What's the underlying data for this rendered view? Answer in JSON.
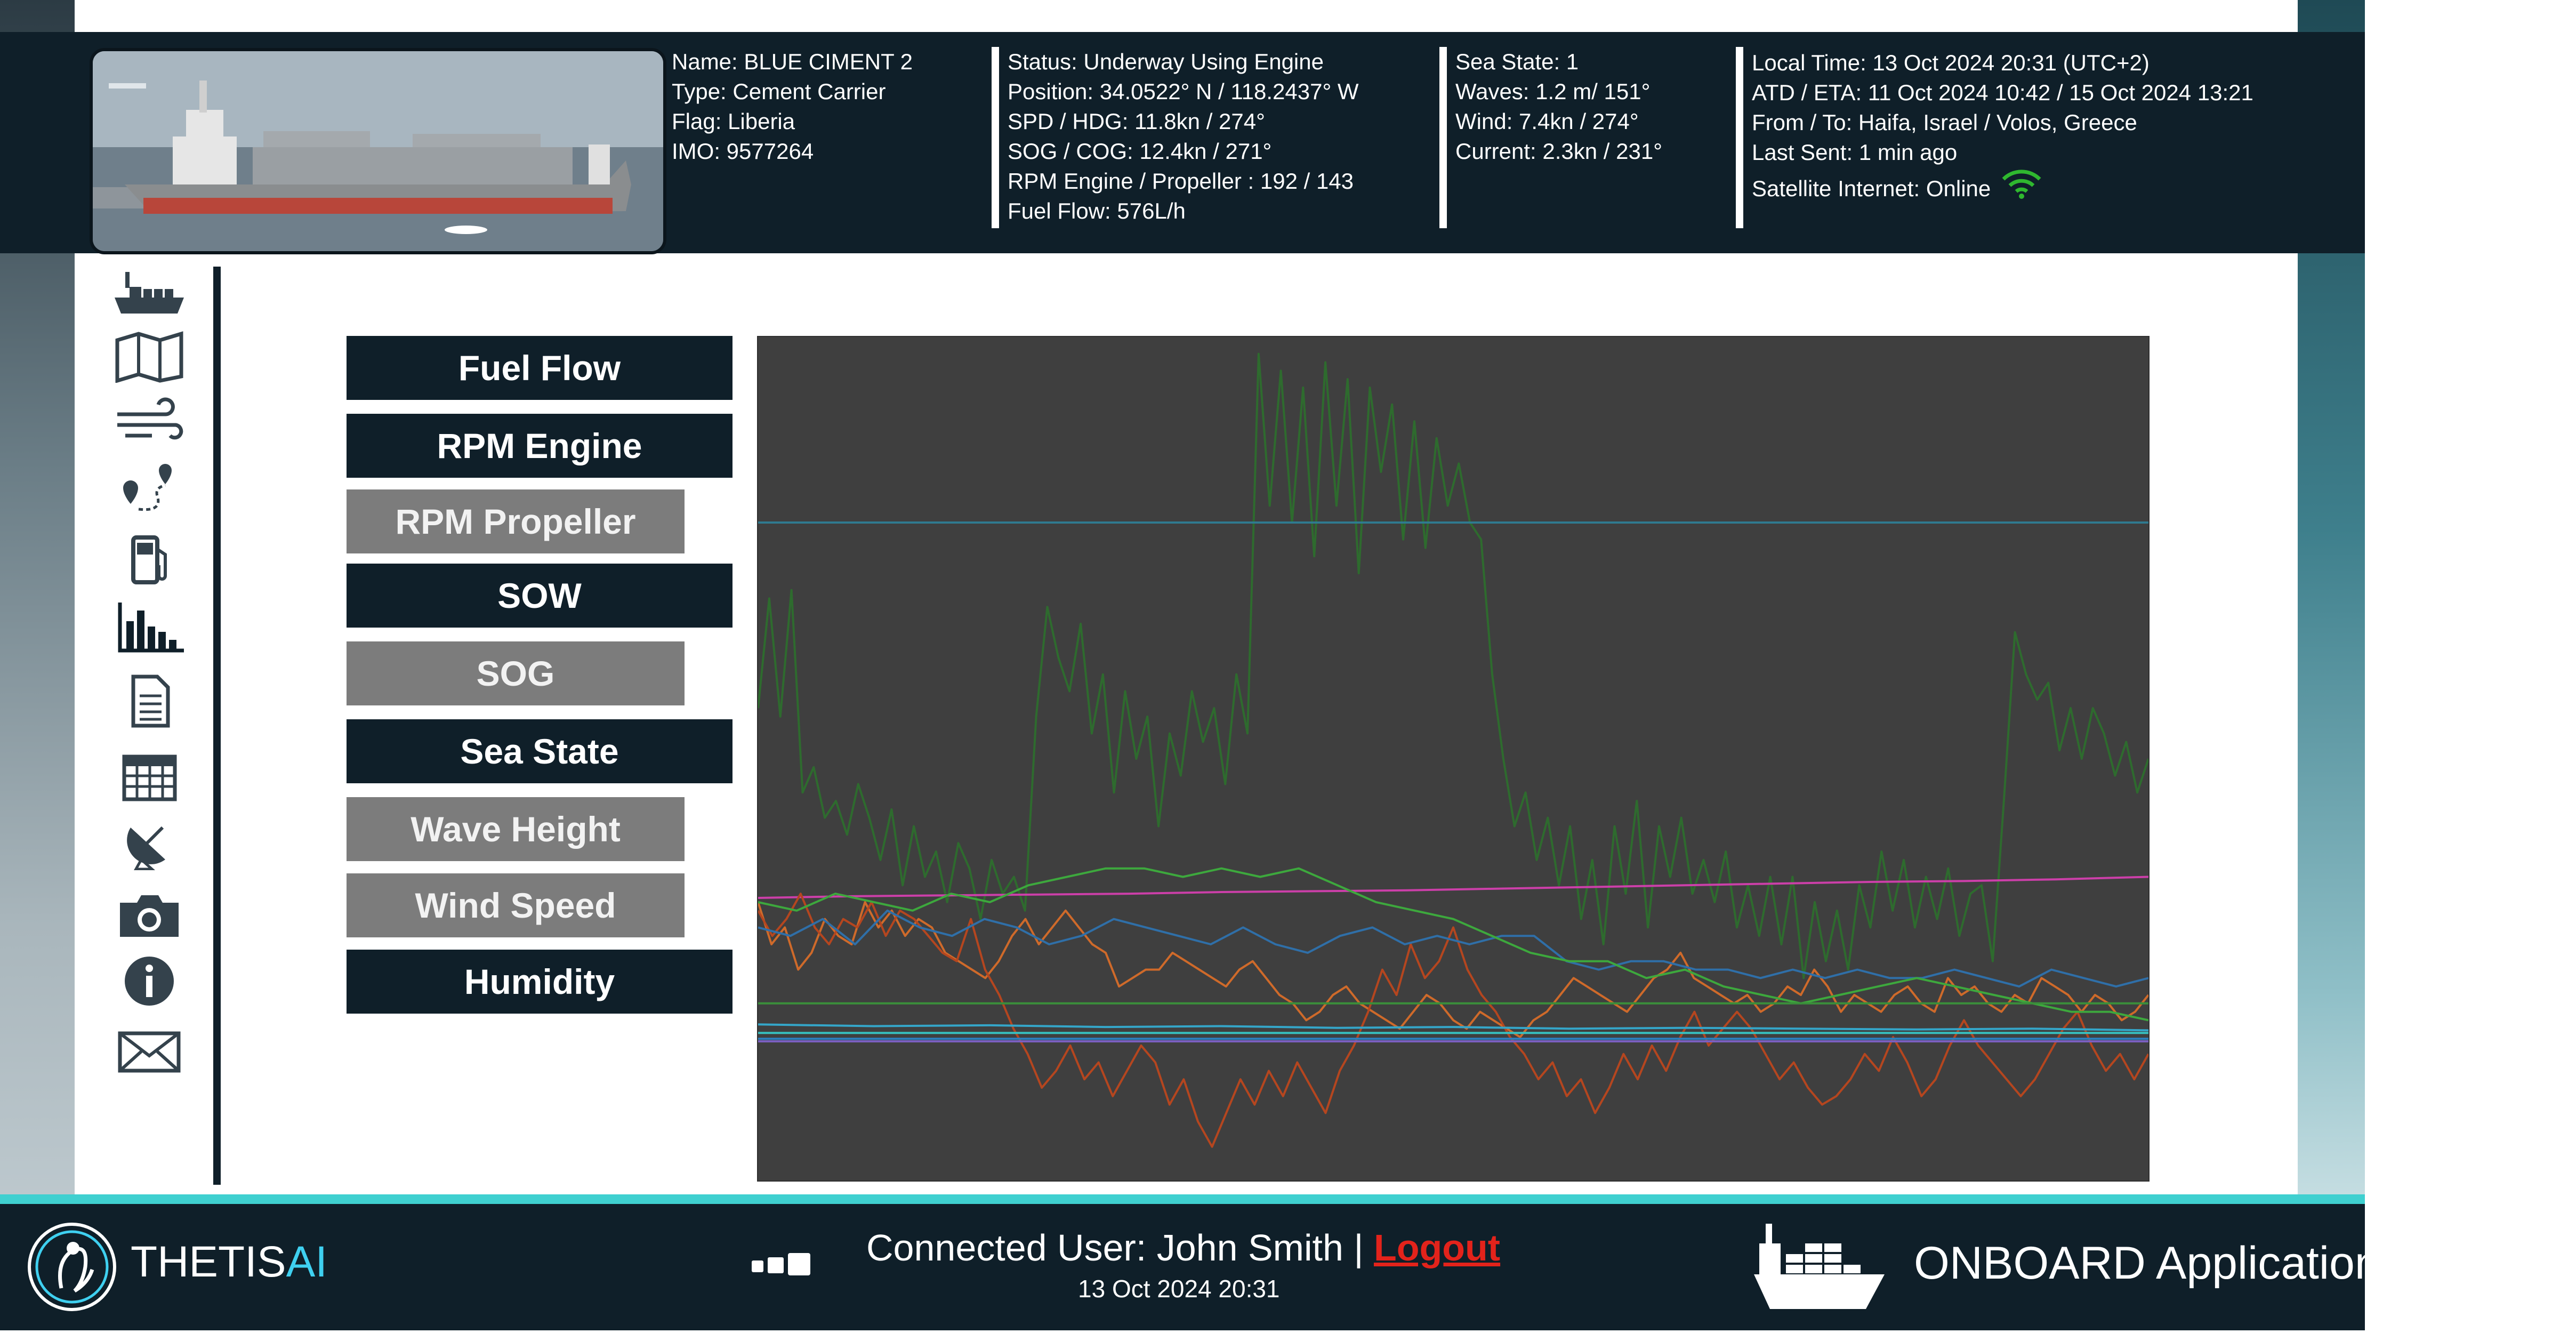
{
  "vessel": {
    "name": "Name: BLUE CIMENT 2",
    "type": "Type: Cement Carrier",
    "flag": "Flag: Liberia",
    "imo": "IMO: 9577264"
  },
  "navigation": {
    "status": "Status: Underway Using Engine",
    "position": "Position: 34.0522° N / 118.2437° W",
    "spd_hdg": "SPD / HDG: 11.8kn / 274°",
    "sog_cog": "SOG / COG: 12.4kn / 271°",
    "rpm": "RPM Engine / Propeller : 192 / 143",
    "fuel_flow": "Fuel Flow: 576L/h"
  },
  "weather": {
    "sea_state": "Sea State: 1",
    "waves": "Waves: 1.2 m/ 151°",
    "wind": "Wind: 7.4kn / 274°",
    "current": "Current: 2.3kn / 231°"
  },
  "voyage": {
    "local_time": "Local Time: 13 Oct 2024 20:31 (UTC+2)",
    "atd_eta": "ATD / ETA: 11 Oct 2024 10:42  / 15 Oct 2024 13:21",
    "from_to": "From / To: Haifa, Israel / Volos, Greece",
    "last_sent": "Last Sent: 1 min ago",
    "satellite": "Satellite Internet: Online"
  },
  "metrics": [
    {
      "label": "Fuel Flow",
      "state": "active"
    },
    {
      "label": "RPM Engine",
      "state": "active"
    },
    {
      "label": "RPM Propeller",
      "state": "inactive"
    },
    {
      "label": "SOW",
      "state": "active"
    },
    {
      "label": "SOG",
      "state": "inactive"
    },
    {
      "label": "Sea State",
      "state": "active"
    },
    {
      "label": "Wave Height",
      "state": "inactive"
    },
    {
      "label": "Wind Speed",
      "state": "inactive"
    },
    {
      "label": "Humidity",
      "state": "active"
    }
  ],
  "sidebar": [
    "ship-icon",
    "map-icon",
    "wind-icon",
    "route-icon",
    "fuel-pump-icon",
    "bar-chart-icon",
    "document-icon",
    "calendar-icon",
    "satellite-dish-icon",
    "camera-icon",
    "info-icon",
    "mail-icon"
  ],
  "footer": {
    "brand_main": "THETIS",
    "brand_ai": "AI",
    "connected_user": "Connected User: John Smith | ",
    "logout": "Logout",
    "date": "13 Oct 2024 20:31",
    "app_label": "ONBOARD Application"
  },
  "colors": {
    "dark": "#0f1f29",
    "accent": "#3fd0d0",
    "inactive": "#7c7c7c",
    "chart_bg": "#3f3f3f",
    "online": "#2fb82f"
  },
  "chart_data": {
    "type": "line",
    "title": "",
    "xlabel": "",
    "ylabel": "",
    "grid": false,
    "legend": "none",
    "series": [
      {
        "color": "#2e6b2e",
        "values": [
          0.56,
          0.69,
          0.55,
          0.7,
          0.46,
          0.49,
          0.43,
          0.45,
          0.41,
          0.47,
          0.43,
          0.38,
          0.44,
          0.35,
          0.42,
          0.36,
          0.39,
          0.33,
          0.4,
          0.37,
          0.31,
          0.38,
          0.34,
          0.36,
          0.32,
          0.55,
          0.68,
          0.62,
          0.58,
          0.66,
          0.53,
          0.6,
          0.46,
          0.58,
          0.5,
          0.55,
          0.42,
          0.53,
          0.48,
          0.58,
          0.52,
          0.56,
          0.47,
          0.6,
          0.53,
          0.98,
          0.8,
          0.96,
          0.78,
          0.94,
          0.74,
          0.97,
          0.8,
          0.95,
          0.72,
          0.94,
          0.84,
          0.92,
          0.76,
          0.9,
          0.75,
          0.88,
          0.8,
          0.85,
          0.78,
          0.76,
          0.6,
          0.5,
          0.42,
          0.46,
          0.38,
          0.43,
          0.35,
          0.42,
          0.31,
          0.38,
          0.28,
          0.42,
          0.34,
          0.45,
          0.3,
          0.42,
          0.36,
          0.43,
          0.34,
          0.38,
          0.33,
          0.39,
          0.3,
          0.35,
          0.29,
          0.36,
          0.28,
          0.36,
          0.24,
          0.33,
          0.26,
          0.32,
          0.25,
          0.35,
          0.3,
          0.39,
          0.32,
          0.38,
          0.3,
          0.36,
          0.31,
          0.37,
          0.29,
          0.34,
          0.35,
          0.26,
          0.45,
          0.65,
          0.6,
          0.57,
          0.59,
          0.51,
          0.56,
          0.5,
          0.56,
          0.53,
          0.48,
          0.52,
          0.46,
          0.5
        ]
      },
      {
        "color": "#2f7a8f",
        "values": [
          0.78,
          0.78
        ]
      },
      {
        "color": "#cc3fa9",
        "values": [
          0.335,
          0.337,
          0.338,
          0.339,
          0.34,
          0.342,
          0.343,
          0.344,
          0.346,
          0.348,
          0.35,
          0.352,
          0.354,
          0.355,
          0.357,
          0.36
        ]
      },
      {
        "color": "#cf6a2a",
        "values": [
          0.33,
          0.28,
          0.3,
          0.25,
          0.27,
          0.31,
          0.29,
          0.28,
          0.33,
          0.3,
          0.32,
          0.29,
          0.31,
          0.3,
          0.27,
          0.26,
          0.25,
          0.24,
          0.26,
          0.29,
          0.31,
          0.28,
          0.3,
          0.32,
          0.3,
          0.28,
          0.27,
          0.23,
          0.24,
          0.25,
          0.25,
          0.27,
          0.26,
          0.25,
          0.24,
          0.23,
          0.25,
          0.26,
          0.24,
          0.22,
          0.21,
          0.19,
          0.2,
          0.22,
          0.23,
          0.21,
          0.2,
          0.19,
          0.18,
          0.2,
          0.22,
          0.21,
          0.19,
          0.18,
          0.2,
          0.19,
          0.18,
          0.17,
          0.19,
          0.2,
          0.22,
          0.24,
          0.23,
          0.22,
          0.21,
          0.2,
          0.22,
          0.24,
          0.25,
          0.27,
          0.24,
          0.23,
          0.22,
          0.21,
          0.22,
          0.2,
          0.21,
          0.23,
          0.22,
          0.25,
          0.23,
          0.2,
          0.22,
          0.21,
          0.2,
          0.22,
          0.23,
          0.21,
          0.2,
          0.24,
          0.22,
          0.23,
          0.21,
          0.2,
          0.22,
          0.21,
          0.24,
          0.23,
          0.22,
          0.2,
          0.22,
          0.21,
          0.19,
          0.2,
          0.22
        ]
      },
      {
        "color": "#b5461f",
        "values": [
          0.32,
          0.29,
          0.31,
          0.34,
          0.3,
          0.28,
          0.31,
          0.3,
          0.33,
          0.29,
          0.32,
          0.31,
          0.29,
          0.27,
          0.26,
          0.31,
          0.25,
          0.22,
          0.18,
          0.15,
          0.11,
          0.13,
          0.16,
          0.12,
          0.14,
          0.1,
          0.13,
          0.16,
          0.14,
          0.09,
          0.12,
          0.07,
          0.04,
          0.08,
          0.12,
          0.09,
          0.13,
          0.1,
          0.14,
          0.11,
          0.08,
          0.13,
          0.16,
          0.2,
          0.25,
          0.22,
          0.28,
          0.24,
          0.26,
          0.3,
          0.25,
          0.22,
          0.2,
          0.17,
          0.15,
          0.12,
          0.14,
          0.1,
          0.12,
          0.08,
          0.11,
          0.15,
          0.12,
          0.16,
          0.13,
          0.17,
          0.2,
          0.16,
          0.18,
          0.2,
          0.18,
          0.15,
          0.12,
          0.14,
          0.11,
          0.09,
          0.1,
          0.12,
          0.15,
          0.13,
          0.17,
          0.14,
          0.1,
          0.12,
          0.16,
          0.19,
          0.16,
          0.14,
          0.12,
          0.1,
          0.12,
          0.15,
          0.18,
          0.2,
          0.16,
          0.13,
          0.15,
          0.12,
          0.15
        ]
      },
      {
        "color": "#2f6fa8",
        "values": [
          0.3,
          0.29,
          0.31,
          0.28,
          0.32,
          0.3,
          0.29,
          0.31,
          0.3,
          0.28,
          0.29,
          0.31,
          0.3,
          0.29,
          0.28,
          0.3,
          0.28,
          0.27,
          0.29,
          0.3,
          0.28,
          0.29,
          0.28,
          0.29,
          0.29,
          0.26,
          0.25,
          0.26,
          0.26,
          0.25,
          0.25,
          0.24,
          0.25,
          0.24,
          0.25,
          0.24,
          0.24,
          0.25,
          0.24,
          0.23,
          0.25,
          0.24,
          0.23,
          0.24
        ]
      },
      {
        "color": "#3da83d",
        "values": [
          0.33,
          0.32,
          0.34,
          0.33,
          0.32,
          0.34,
          0.33,
          0.35,
          0.36,
          0.37,
          0.37,
          0.36,
          0.37,
          0.36,
          0.37,
          0.35,
          0.33,
          0.32,
          0.31,
          0.29,
          0.27,
          0.26,
          0.26,
          0.24,
          0.25,
          0.23,
          0.22,
          0.21,
          0.22,
          0.23,
          0.24,
          0.23,
          0.22,
          0.21,
          0.2,
          0.2,
          0.19
        ]
      },
      {
        "color": "#3a8f3a",
        "values": [
          0.21,
          0.21
        ]
      },
      {
        "color": "#34a6c9",
        "values": [
          0.185,
          0.183,
          0.184,
          0.182,
          0.183,
          0.181,
          0.182,
          0.18,
          0.181,
          0.18,
          0.179,
          0.18,
          0.178
        ]
      },
      {
        "color": "#36c0c0",
        "values": [
          0.175,
          0.175
        ]
      },
      {
        "color": "#2b7fbf",
        "values": [
          0.168,
          0.168
        ]
      },
      {
        "color": "#7a5fc0",
        "values": [
          0.165,
          0.165
        ]
      }
    ]
  }
}
